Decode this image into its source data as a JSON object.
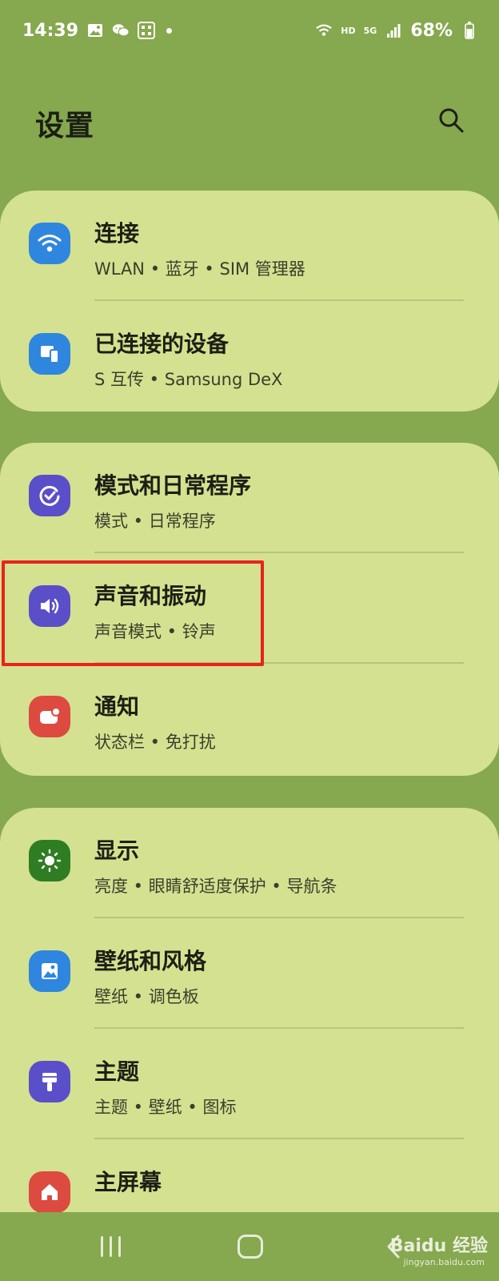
{
  "status_bar": {
    "time": "14:39",
    "network_hd": "HD",
    "network_5g": "5G",
    "battery": "68%"
  },
  "header": {
    "title": "设置",
    "search_icon": "search-icon"
  },
  "groups": [
    {
      "items": [
        {
          "title": "连接",
          "subtitle": "WLAN • 蓝牙 • SIM 管理器",
          "icon": "wifi-icon",
          "color": "#2f86df"
        },
        {
          "title": "已连接的设备",
          "subtitle": "S 互传 • Samsung DeX",
          "icon": "devices-icon",
          "color": "#2f86df"
        }
      ]
    },
    {
      "items": [
        {
          "title": "模式和日常程序",
          "subtitle": "模式 • 日常程序",
          "icon": "modes-check-icon",
          "color": "#5a4fc8"
        },
        {
          "title": "声音和振动",
          "subtitle": "声音模式 • 铃声",
          "icon": "speaker-icon",
          "color": "#5a4fc8"
        },
        {
          "title": "通知",
          "subtitle": "状态栏 • 免打扰",
          "icon": "notification-icon",
          "color": "#dc4a40"
        }
      ]
    },
    {
      "items": [
        {
          "title": "显示",
          "subtitle": "亮度 • 眼睛舒适度保护 • 导航条",
          "icon": "brightness-icon",
          "color": "#2f7d23"
        },
        {
          "title": "壁纸和风格",
          "subtitle": "壁纸 • 调色板",
          "icon": "wallpaper-icon",
          "color": "#2f86df"
        },
        {
          "title": "主题",
          "subtitle": "主题 • 壁纸 • 图标",
          "icon": "theme-brush-icon",
          "color": "#5a4fc8"
        },
        {
          "title": "主屏幕",
          "subtitle": "",
          "icon": "home-icon",
          "color": "#dc4a40"
        }
      ]
    }
  ],
  "highlight": {
    "color": "#e8231d"
  },
  "watermark": {
    "brand": "Baidu 经验",
    "url": "jingyan.baidu.com"
  }
}
